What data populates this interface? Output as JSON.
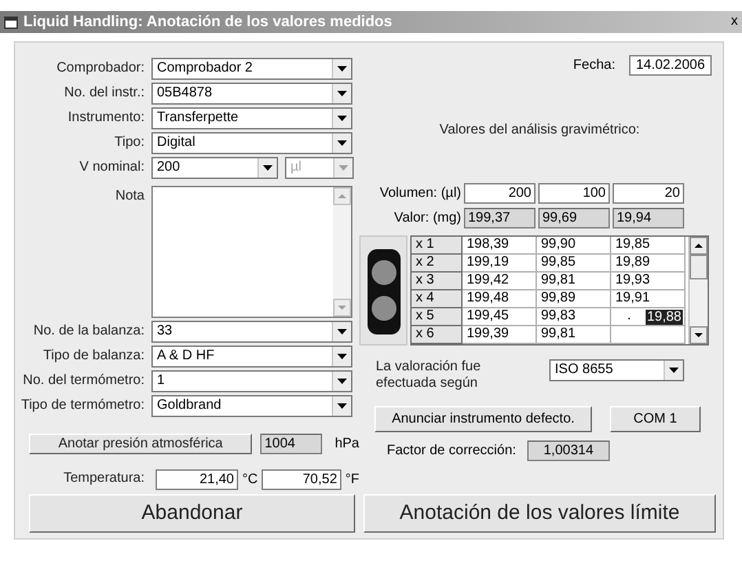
{
  "window": {
    "title": "Liquid Handling: Anotación de los valores medidos",
    "close": "x"
  },
  "fields_top": [
    {
      "label": "Comprobador:",
      "value": "Comprobador 2"
    },
    {
      "label": "No. del instr.:",
      "value": "05B4878"
    },
    {
      "label": "Instrumento:",
      "value": "Transferpette"
    },
    {
      "label": "Tipo:",
      "value": "Digital"
    }
  ],
  "v_nominal": {
    "label": "V nominal:",
    "value": "200",
    "unit": "µl",
    "unit_disabled": true
  },
  "nota": {
    "label": "Nota"
  },
  "fields_bottom": [
    {
      "label": "No. de la balanza:",
      "value": "33"
    },
    {
      "label": "Tipo de balanza:",
      "value": "A & D HF"
    },
    {
      "label": "No. del termómetro:",
      "value": "1"
    },
    {
      "label": "Tipo de termómetro:",
      "value": "Goldbrand"
    }
  ],
  "pressure": {
    "button": "Anotar presión atmosférica",
    "value": "1004",
    "unit": "hPa"
  },
  "temperature": {
    "label": "Temperatura:",
    "celsius": "21,40",
    "celsius_unit": "°C",
    "fahrenheit": "70,52",
    "fahrenheit_unit": "°F"
  },
  "date": {
    "label": "Fecha:",
    "value": "14.02.2006"
  },
  "gravimetric": {
    "title": "Valores del análisis gravimétrico:",
    "volume_label": "Volumen: (µl)",
    "volumes": [
      "200",
      "100",
      "20"
    ],
    "value_label": "Valor:  (mg)",
    "values": [
      "199,37",
      "99,69",
      "19,94"
    ]
  },
  "grid": {
    "rows": [
      {
        "label": "x 1",
        "cells": [
          "198,39",
          "99,90",
          "19,85"
        ]
      },
      {
        "label": "x 2",
        "cells": [
          "199,19",
          "99,85",
          "19,89"
        ]
      },
      {
        "label": "x 3",
        "cells": [
          "199,42",
          "99,81",
          "19,93"
        ]
      },
      {
        "label": "x 4",
        "cells": [
          "199,48",
          "99,89",
          "19,91"
        ]
      },
      {
        "label": "x 5",
        "cells": [
          "199,45",
          "99,83",
          "."
        ],
        "edit_value": "19,88"
      },
      {
        "label": "x 6",
        "cells": [
          "199,39",
          "99,81"
        ]
      }
    ]
  },
  "standard": {
    "label": "La valoración fue efectuada según",
    "value": "ISO 8655"
  },
  "buttons": {
    "defect": "Anunciar instrumento defecto.",
    "com": "COM 1"
  },
  "correction": {
    "label": "Factor de corrección:",
    "value": "1,00314"
  },
  "actions": [
    "Abandonar",
    "Anotación de los valores límite"
  ]
}
